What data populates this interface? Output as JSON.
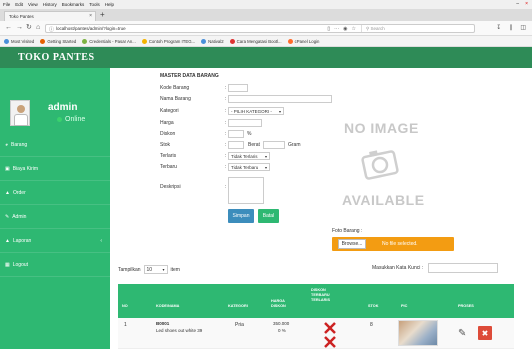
{
  "browser": {
    "menu": [
      "File",
      "Edit",
      "View",
      "History",
      "Bookmarks",
      "Tools",
      "Help"
    ],
    "tab_title": "Toko Pantes",
    "url": "localhost/pantes/admin/?login=true",
    "search_placeholder": "Search",
    "bookmarks": [
      "Most Visited",
      "Getting Started",
      "Credentials - Pasar An...",
      "Contoh Program ITEG...",
      "Natival2",
      "Cara Mengatasi Bootl...",
      "cPanel Login"
    ]
  },
  "app": {
    "brand": "TOKO PANTES",
    "header_color": "#2e8b57",
    "sidebar_color": "#2eb872"
  },
  "user": {
    "name": "admin",
    "status": "Online"
  },
  "sidebar": {
    "items": [
      {
        "label": "Barang",
        "icon": "tag-icon"
      },
      {
        "label": "Biaya Kirim",
        "icon": "truck-icon"
      },
      {
        "label": "Order",
        "icon": "cart-icon"
      },
      {
        "label": "Admin",
        "icon": "user-icon"
      },
      {
        "label": "Laporan",
        "icon": "chart-icon"
      },
      {
        "label": "Logout",
        "icon": "logout-icon"
      }
    ]
  },
  "form": {
    "title": "MASTER DATA BARANG",
    "kode_barang": "Kode Barang",
    "nama_barang": "Nama Barang",
    "kategori": "Kategori",
    "kategori_value": "- PILIH KATEGORI -",
    "harga": "Harga",
    "diskon": "Diskon",
    "diskon_unit": "%",
    "stok": "Stok",
    "berat": "Berat",
    "berat_unit": "Gram",
    "terlaris": "Terlaris",
    "terlaris_value": "Tidak Terlaris",
    "terbaru": "Terbaru",
    "terbaru_value": "Tidak Terbaru",
    "deskripsi": "Deskripsi",
    "simpan": "Simpan",
    "batal": "Batal",
    "colon": ":"
  },
  "image_panel": {
    "no_image_top": "NO IMAGE",
    "no_image_bottom": "AVAILABLE",
    "foto_label": "Foto Barang :",
    "browse": "Browse...",
    "no_file": "No file selected."
  },
  "table_controls": {
    "tampilkan": "Tampilkan",
    "length": "10",
    "item": "item",
    "cari": "Masukkan Kata Kunci :"
  },
  "table": {
    "headers": [
      "NO",
      "KODE/NAMA",
      "KATEGORI",
      "HARGA DISKON",
      "DISKON TERBARU TERLARIS",
      "STOK",
      "PIC",
      "PROSES"
    ],
    "rows": [
      {
        "no": "1",
        "kode": "B0001",
        "nama": "Led shoes out white 39",
        "kategori": "Pria",
        "harga": "350.000",
        "diskon": "0 %",
        "stok": "8"
      }
    ]
  }
}
